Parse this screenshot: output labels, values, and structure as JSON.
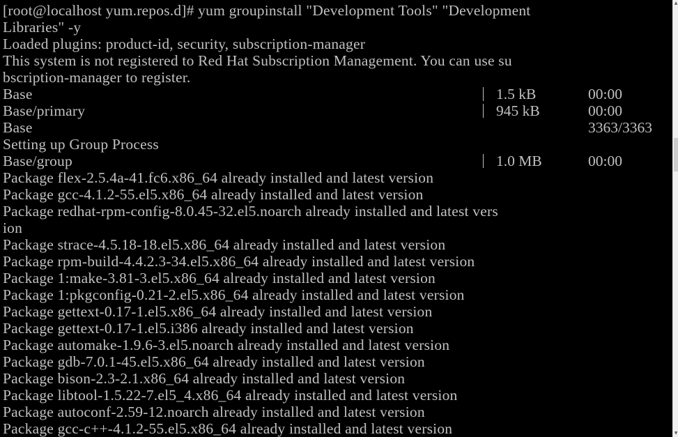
{
  "terminal": {
    "lines": [
      "[root@localhost yum.repos.d]# yum groupinstall \"Development Tools\" \"Development",
      "Libraries\" -y",
      "Loaded plugins: product-id, security, subscription-manager",
      "This system is not registered to Red Hat Subscription Management. You can use su",
      "bscription-manager to register.",
      "Base",
      "Base/primary",
      "Base",
      "Setting up Group Process",
      "Base/group",
      "Package flex-2.5.4a-41.fc6.x86_64 already installed and latest version",
      "Package gcc-4.1.2-55.el5.x86_64 already installed and latest version",
      "Package redhat-rpm-config-8.0.45-32.el5.noarch already installed and latest vers",
      "ion",
      "Package strace-4.5.18-18.el5.x86_64 already installed and latest version",
      "Package rpm-build-4.4.2.3-34.el5.x86_64 already installed and latest version",
      "Package 1:make-3.81-3.el5.x86_64 already installed and latest version",
      "Package 1:pkgconfig-0.21-2.el5.x86_64 already installed and latest version",
      "Package gettext-0.17-1.el5.x86_64 already installed and latest version",
      "Package gettext-0.17-1.el5.i386 already installed and latest version",
      "Package automake-1.9.6-3.el5.noarch already installed and latest version",
      "Package gdb-7.0.1-45.el5.x86_64 already installed and latest version",
      "Package bison-2.3-2.1.x86_64 already installed and latest version",
      "Package libtool-1.5.22-7.el5_4.x86_64 already installed and latest version",
      "Package autoconf-2.59-12.noarch already installed and latest version",
      "Package gcc-c++-4.1.2-55.el5.x86_64 already installed and latest version"
    ],
    "progress_rows": {
      "base_size": "1.5 kB",
      "base_time": "00:00",
      "primary_size": "945 kB",
      "primary_time": "00:00",
      "base_count": "3363/3363",
      "group_size": "1.0 MB",
      "group_time": "00:00"
    },
    "colors": {
      "background": "#000000",
      "text": "#c0c0c0"
    }
  }
}
